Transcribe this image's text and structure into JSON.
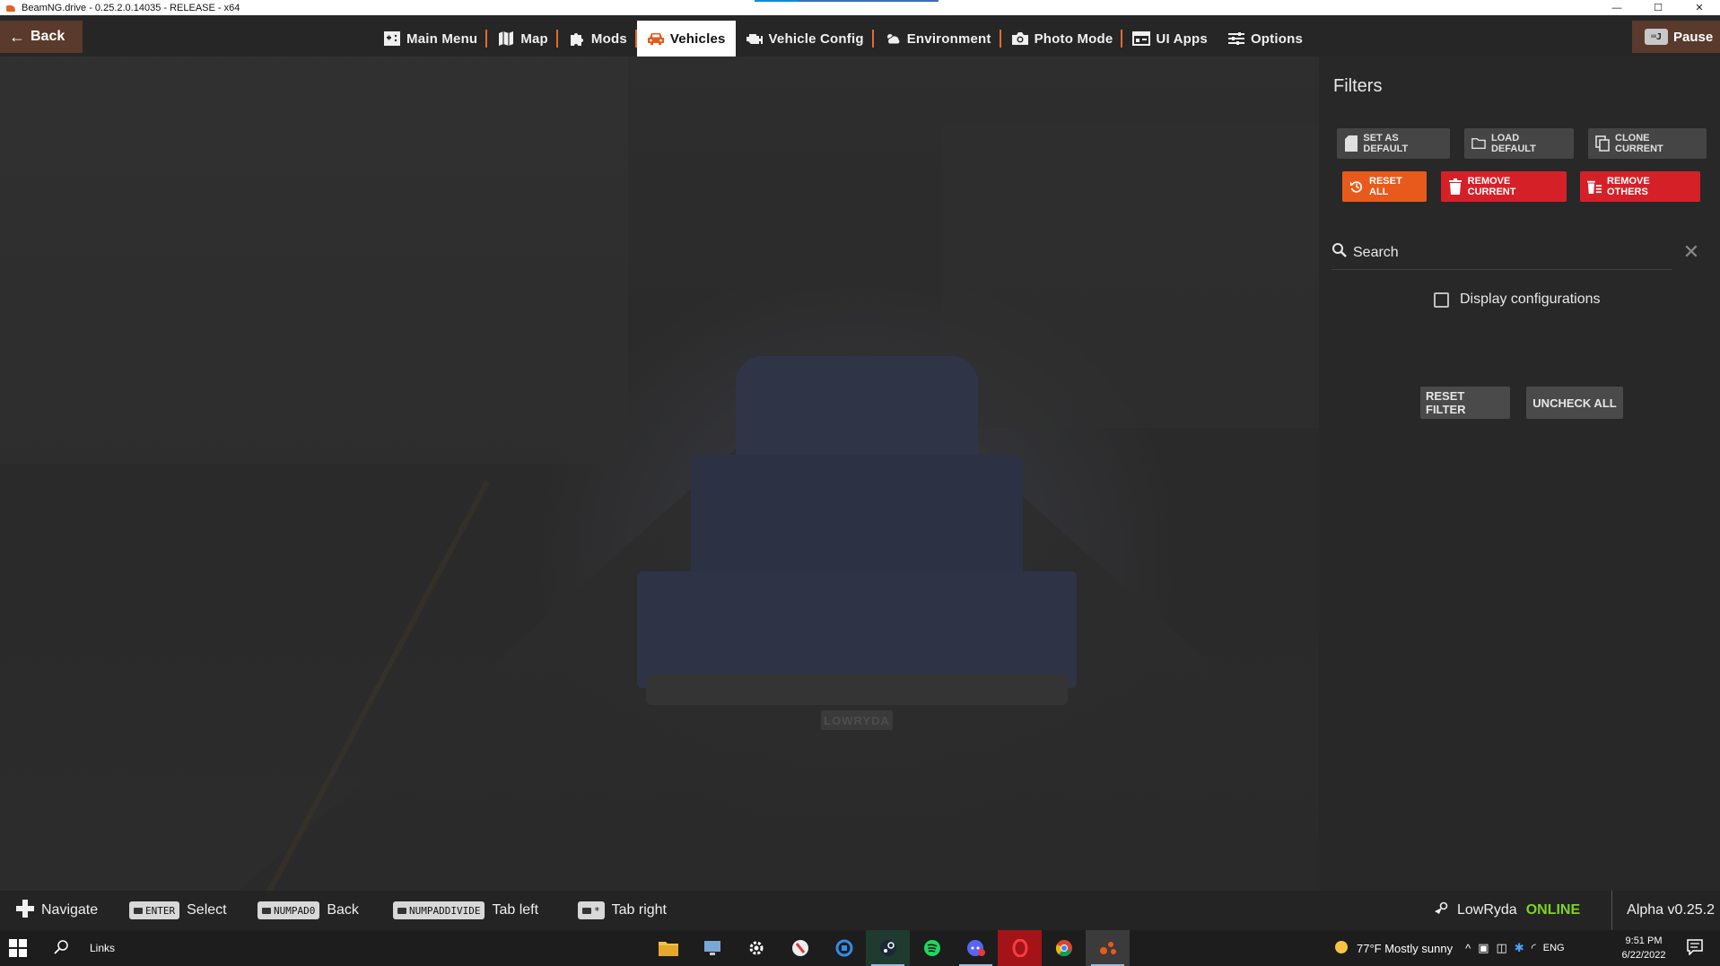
{
  "window": {
    "title": "BeamNG.drive - 0.25.2.0.14035 - RELEASE - x64",
    "controls": [
      "—",
      "☐",
      "✕"
    ]
  },
  "topnav": {
    "back_label": "Back",
    "pause_label": "Pause",
    "tabs": [
      {
        "label": "Main Menu",
        "icon": "main-menu-icon",
        "active": false
      },
      {
        "label": "Map",
        "icon": "map-icon",
        "active": false
      },
      {
        "label": "Mods",
        "icon": "puzzle-icon",
        "active": false
      },
      {
        "label": "Vehicles",
        "icon": "car-icon",
        "active": true
      },
      {
        "label": "Vehicle Config",
        "icon": "engine-icon",
        "active": false
      },
      {
        "label": "Environment",
        "icon": "weather-icon",
        "active": false
      },
      {
        "label": "Photo Mode",
        "icon": "camera-icon",
        "active": false
      },
      {
        "label": "UI Apps",
        "icon": "ui-apps-icon",
        "active": false
      },
      {
        "label": "Options",
        "icon": "sliders-icon",
        "active": false
      }
    ]
  },
  "scene": {
    "plate_text": "LOWRYDA"
  },
  "filters": {
    "title": "Filters",
    "buttons_row1": [
      "SET AS DEFAULT",
      "LOAD DEFAULT",
      "CLONE CURRENT"
    ],
    "reset_all": "RESET ALL",
    "remove_current": "REMOVE CURRENT",
    "remove_others": "REMOVE OTHERS",
    "search_placeholder": "Search",
    "display_configurations": "Display configurations",
    "display_configurations_checked": false,
    "reset_filter": "RESET FILTER",
    "uncheck_all": "UNCHECK ALL"
  },
  "hints": [
    {
      "key": "",
      "label": "Navigate"
    },
    {
      "key": "ENTER",
      "label": "Select"
    },
    {
      "key": "NUMPAD0",
      "label": "Back"
    },
    {
      "key": "NUMPADDIVIDE",
      "label": "Tab left"
    },
    {
      "key": "*",
      "label": "Tab right"
    }
  ],
  "status": {
    "username": "LowRyda",
    "online_label": "ONLINE",
    "version": "Alpha v0.25.2"
  },
  "taskbar": {
    "links_label": "Links",
    "weather": "77°F  Mostly sunny",
    "language": "ENG",
    "time": "9:51 PM",
    "date": "6/22/2022"
  },
  "colors": {
    "accent_orange": "#e85a1b",
    "danger_red": "#d62028",
    "online_green": "#7ed321",
    "back_brown": "#5a3a2c"
  }
}
